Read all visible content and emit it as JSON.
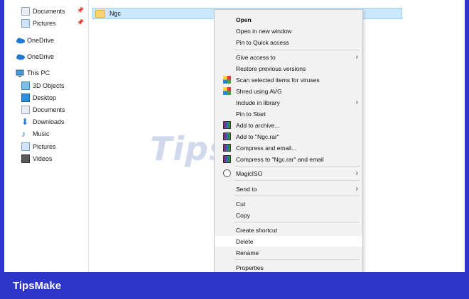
{
  "quick_access": [
    {
      "label": "Documents",
      "icon": "documents-icon",
      "pinned": true
    },
    {
      "label": "Pictures",
      "icon": "pictures-icon",
      "pinned": true
    }
  ],
  "nav_roots": [
    {
      "label": "OneDrive",
      "icon": "cloud-icon"
    },
    {
      "label": "OneDrive",
      "icon": "cloud-icon"
    },
    {
      "label": "This PC",
      "icon": "pc-icon"
    }
  ],
  "this_pc_items": [
    {
      "label": "3D Objects",
      "icon": "3d-objects-icon"
    },
    {
      "label": "Desktop",
      "icon": "desktop-icon"
    },
    {
      "label": "Documents",
      "icon": "documents-icon"
    },
    {
      "label": "Downloads",
      "icon": "downloads-icon"
    },
    {
      "label": "Music",
      "icon": "music-icon"
    },
    {
      "label": "Pictures",
      "icon": "pictures-icon"
    },
    {
      "label": "Videos",
      "icon": "videos-icon"
    }
  ],
  "selected_file": {
    "name": "Ngc"
  },
  "context_menu": {
    "open": "Open",
    "open_new_window": "Open in new window",
    "pin_quick_access": "Pin to Quick access",
    "give_access": "Give access to",
    "restore_versions": "Restore previous versions",
    "scan_viruses": "Scan selected items for viruses",
    "shred_avg": "Shred using AVG",
    "include_library": "Include in library",
    "pin_start": "Pin to Start",
    "add_archive": "Add to archive...",
    "add_ngc_rar": "Add to \"Ngc.rar\"",
    "compress_email": "Compress and email...",
    "compress_ngc_email": "Compress to \"Ngc.rar\" and email",
    "magiciso": "MagicISO",
    "send_to": "Send to",
    "cut": "Cut",
    "copy": "Copy",
    "create_shortcut": "Create shortcut",
    "delete": "Delete",
    "rename": "Rename",
    "properties": "Properties"
  },
  "watermark": "TipsMake",
  "footer": {
    "brand": "TipsMake"
  },
  "colors": {
    "accent": "#2e35c9",
    "selection": "#cce8ff",
    "menu_bg": "#f2f2f2"
  }
}
